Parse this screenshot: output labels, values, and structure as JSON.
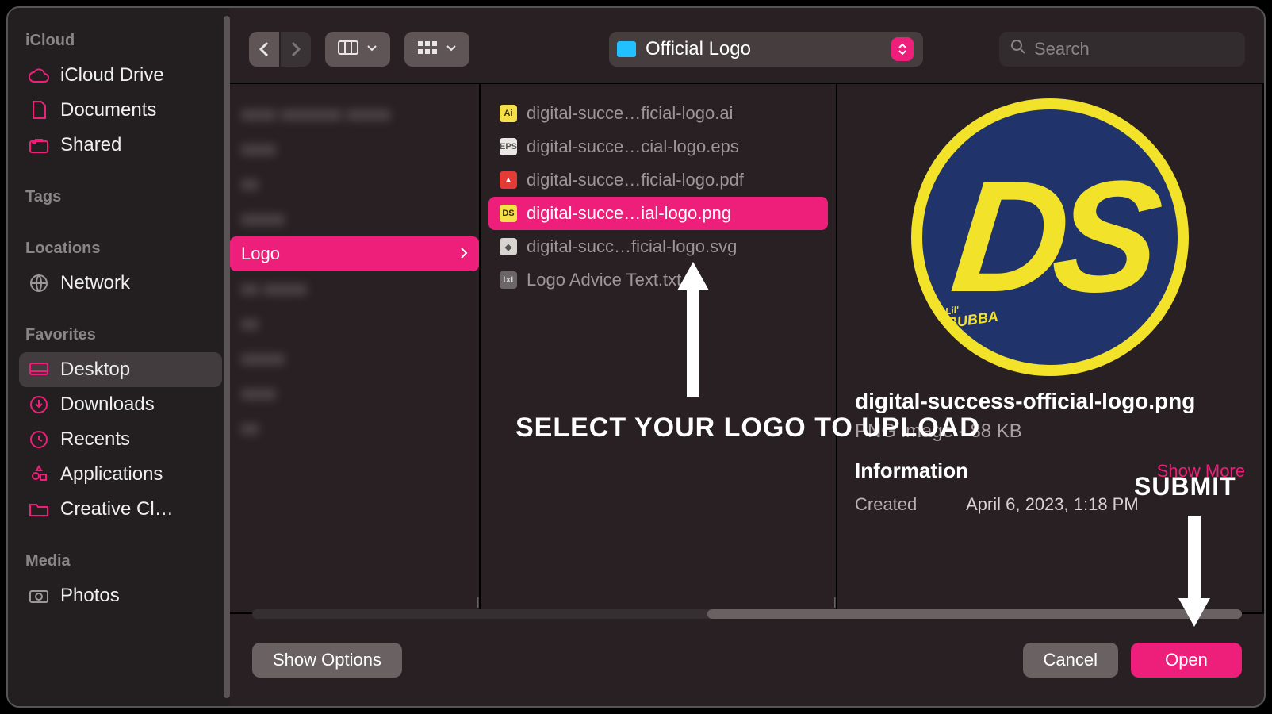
{
  "sidebar": {
    "sections": [
      {
        "title": "iCloud",
        "items": [
          {
            "icon": "cloud",
            "label": "iCloud Drive"
          },
          {
            "icon": "doc",
            "label": "Documents"
          },
          {
            "icon": "shared",
            "label": "Shared"
          }
        ]
      },
      {
        "title": "Tags",
        "items": []
      },
      {
        "title": "Locations",
        "items": [
          {
            "icon": "globe",
            "label": "Network"
          }
        ]
      },
      {
        "title": "Favorites",
        "items": [
          {
            "icon": "desktop",
            "label": "Desktop",
            "active": true
          },
          {
            "icon": "download",
            "label": "Downloads"
          },
          {
            "icon": "clock",
            "label": "Recents"
          },
          {
            "icon": "apps",
            "label": "Applications"
          },
          {
            "icon": "folder",
            "label": "Creative Cl…"
          }
        ]
      },
      {
        "title": "Media",
        "items": [
          {
            "icon": "camera",
            "label": "Photos"
          }
        ]
      }
    ]
  },
  "toolbar": {
    "path_label": "Official Logo",
    "search_placeholder": "Search"
  },
  "columns": {
    "col1_selected": "Logo",
    "col2": [
      {
        "type": "ai",
        "label": "digital-succe…ficial-logo.ai"
      },
      {
        "type": "eps",
        "label": "digital-succe…cial-logo.eps"
      },
      {
        "type": "pdf",
        "label": "digital-succe…ficial-logo.pdf"
      },
      {
        "type": "png",
        "label": "digital-succe…ial-logo.png",
        "selected": true
      },
      {
        "type": "svg",
        "label": "digital-succ…ficial-logo.svg"
      },
      {
        "type": "txt",
        "label": "Logo Advice Text.txt"
      }
    ]
  },
  "preview": {
    "filename": "digital-success-official-logo.png",
    "subtitle": "PNG image - 88 KB",
    "info_label": "Information",
    "show_more": "Show More",
    "created_label": "Created",
    "created_value": "April 6, 2023, 1:18 PM",
    "logo_text": "DS",
    "logo_sub1": "Lil'",
    "logo_sub2": "BUBBA"
  },
  "footer": {
    "show_options": "Show Options",
    "cancel": "Cancel",
    "open": "Open"
  },
  "annotations": {
    "select": "SELECT YOUR LOGO TO UPLOAD",
    "submit": "SUBMIT"
  },
  "colors": {
    "accent": "#ee1f7a"
  }
}
